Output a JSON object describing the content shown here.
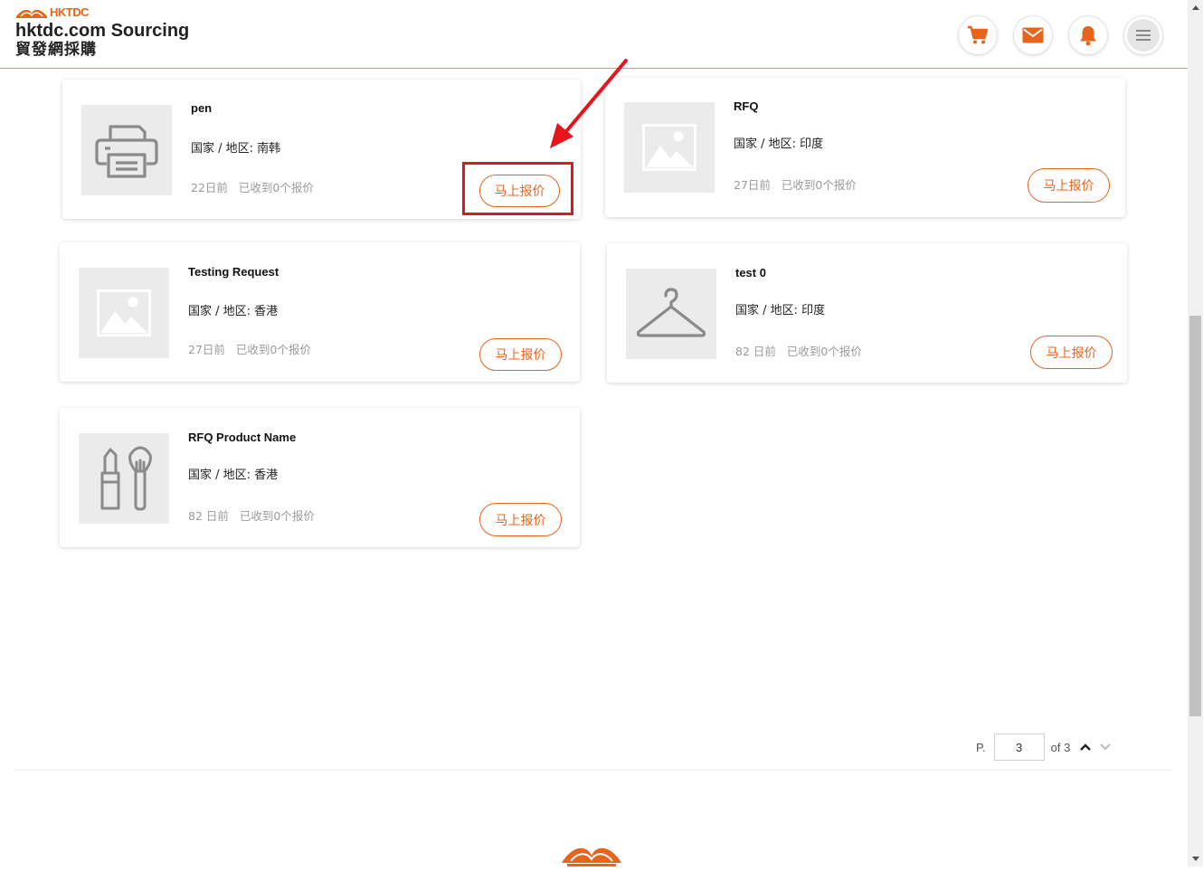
{
  "header": {
    "brand_tag": "HKTDC",
    "brand_title": "hktdc.com Sourcing",
    "brand_subtitle": "貿發網採購",
    "icons": [
      "cart-icon",
      "mail-icon",
      "bell-icon",
      "menu-icon"
    ]
  },
  "cards": [
    {
      "title": "pen",
      "region": "国家 / 地区: 南韩",
      "age": "22日前",
      "quotes": "已收到0个报价",
      "button": "马上报价",
      "thumb_icon": "printer-icon"
    },
    {
      "title": "RFQ",
      "region": "国家 / 地区: 印度",
      "age": "27日前",
      "quotes": "已收到0个报价",
      "button": "马上报价",
      "thumb_icon": "image-placeholder-icon"
    },
    {
      "title": "Testing Request",
      "region": "国家 / 地区: 香港",
      "age": "27日前",
      "quotes": "已收到0个报价",
      "button": "马上报价",
      "thumb_icon": "image-placeholder-icon"
    },
    {
      "title": "test 0",
      "region": "国家 / 地区: 印度",
      "age": "82 日前",
      "quotes": "已收到0个报价",
      "button": "马上报价",
      "thumb_icon": "hanger-icon"
    },
    {
      "title": "RFQ Product Name",
      "region": "国家 / 地区: 香港",
      "age": "82 日前",
      "quotes": "已收到0个报价",
      "button": "马上报价",
      "thumb_icon": "cosmetics-icon"
    }
  ],
  "pagination": {
    "prefix": "P.",
    "current": "3",
    "total_label": "of 3"
  },
  "colors": {
    "accent": "#e8641b",
    "annotation": "#e8141b",
    "divider": "#c9a46a"
  }
}
